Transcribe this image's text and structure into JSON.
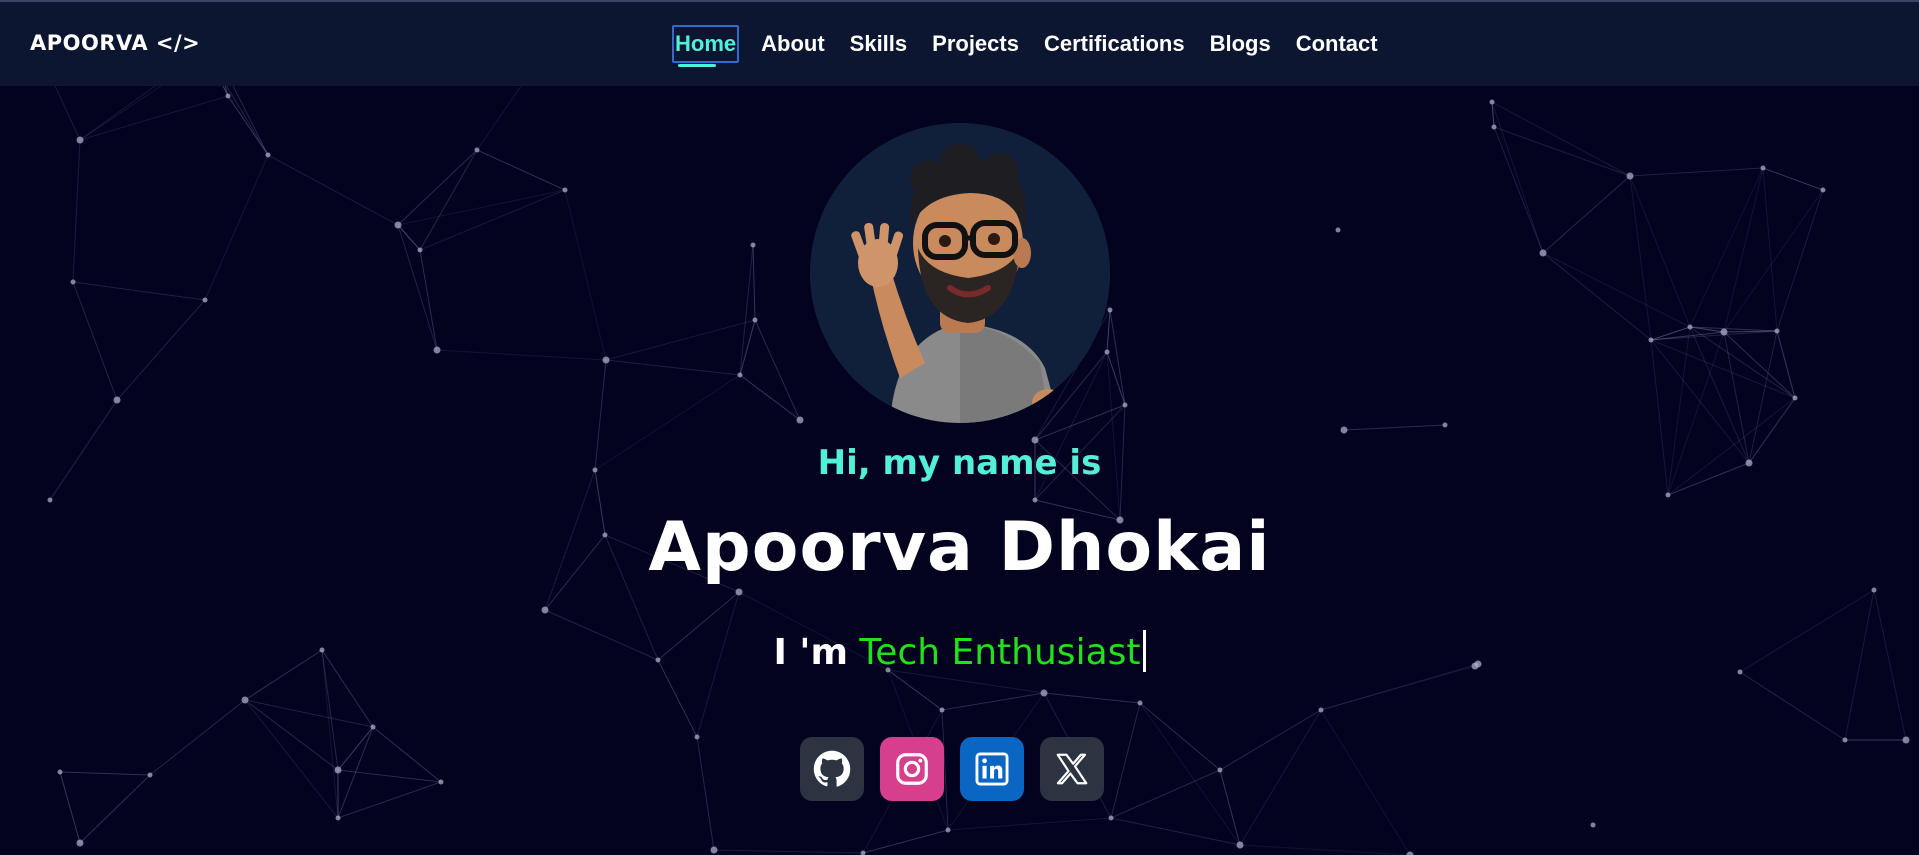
{
  "logo": "APOORVA </>",
  "nav": {
    "items": [
      {
        "label": "Home",
        "active": true
      },
      {
        "label": "About"
      },
      {
        "label": "Skills"
      },
      {
        "label": "Projects"
      },
      {
        "label": "Certifications"
      },
      {
        "label": "Blogs"
      },
      {
        "label": "Contact"
      }
    ]
  },
  "hero": {
    "greeting": "Hi, my name is",
    "name": "Apoorva Dhokai",
    "role_prefix": "I 'm",
    "role_typed": "Tech Enthusiast"
  },
  "socials": [
    {
      "name": "github",
      "icon": "github-icon",
      "color": "#2b3440"
    },
    {
      "name": "instagram",
      "icon": "instagram-icon",
      "color": "#d63f8c"
    },
    {
      "name": "linkedin",
      "icon": "linkedin-icon",
      "color": "#0a66c2"
    },
    {
      "name": "x",
      "icon": "x-icon",
      "color": "#2b3440"
    }
  ],
  "colors": {
    "background": "#03031f",
    "navbar": "#0c1630",
    "accent": "#54f0d6",
    "typed_text": "#22e01a"
  }
}
